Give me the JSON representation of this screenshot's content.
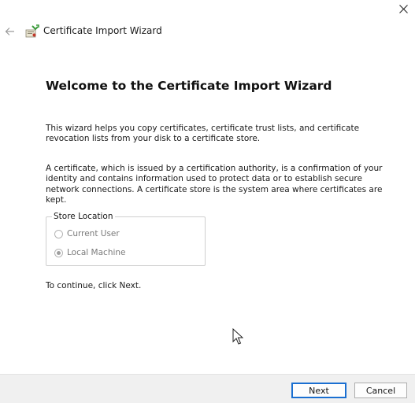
{
  "header": {
    "title": "Certificate Import Wizard"
  },
  "main": {
    "heading": "Welcome to the Certificate Import Wizard",
    "intro": "This wizard helps you copy certificates, certificate trust lists, and certificate revocation lists from your disk to a certificate store.",
    "description": "A certificate, which is issued by a certification authority, is a confirmation of your identity and contains information used to protect data or to establish secure network connections. A certificate store is the system area where certificates are kept.",
    "store_location": {
      "legend": "Store Location",
      "options": [
        {
          "label": "Current User",
          "selected": false,
          "enabled": false
        },
        {
          "label": "Local Machine",
          "selected": true,
          "enabled": false
        }
      ]
    },
    "continue_text": "To continue, click Next."
  },
  "footer": {
    "next_label": "Next",
    "cancel_label": "Cancel"
  },
  "icons": {
    "close": "close-icon",
    "back": "back-arrow-icon",
    "wizard": "certificate-wizard-icon",
    "cursor": "mouse-cursor-icon"
  },
  "colors": {
    "accent": "#1a6fd1",
    "footer_bg": "#f0f0f0",
    "disabled_text": "#7a7a7a"
  }
}
